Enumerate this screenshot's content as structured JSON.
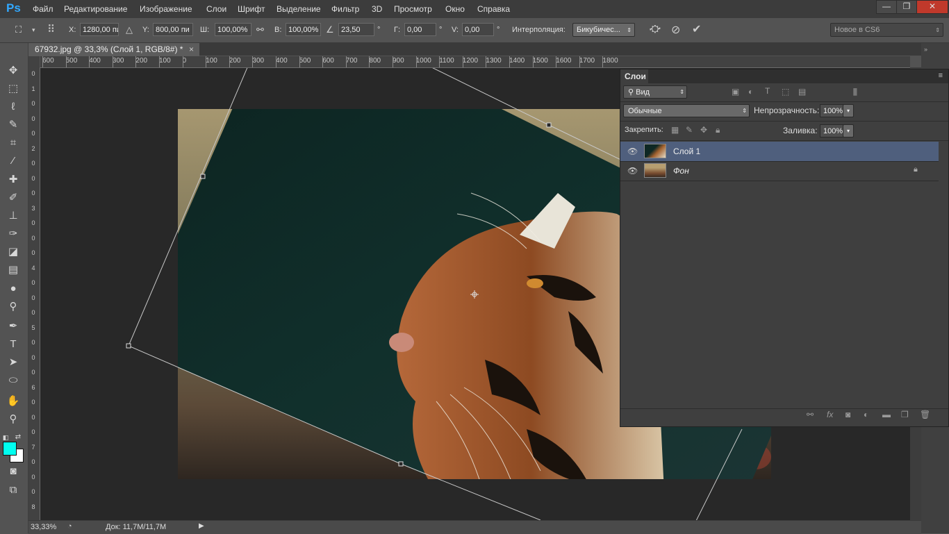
{
  "app": {
    "logo": "Ps",
    "menu": [
      "Файл",
      "Редактирование",
      "Изображение",
      "Слои",
      "Шрифт",
      "Выделение",
      "Фильтр",
      "3D",
      "Просмотр",
      "Окно",
      "Справка"
    ],
    "window_controls": {
      "minimize": "—",
      "restore": "❐",
      "close": "✕"
    }
  },
  "options_bar": {
    "x_label": "X:",
    "x_value": "1280,00 пи",
    "y_label": "Y:",
    "y_value": "800,00 пи",
    "w_label": "Ш:",
    "w_value": "100,00%",
    "h_label": "В:",
    "h_value": "100,00%",
    "angle_value": "23,50",
    "degree": "°",
    "hskew_label": "Г:",
    "hskew_value": "0,00",
    "vskew_label": "V:",
    "vskew_value": "0,00",
    "interp_label": "Интерполяция:",
    "interp_value": "Бикубичес...",
    "workspace": "Новое в CS6"
  },
  "document": {
    "tab_title": "67932.jpg @ 33,3% (Слой 1, RGB/8#) *",
    "tab_close": "×"
  },
  "ruler": {
    "h_labels": [
      "600",
      "500",
      "400",
      "300",
      "200",
      "100",
      "0",
      "100",
      "200",
      "300",
      "400",
      "500",
      "600",
      "700",
      "800",
      "900",
      "1000",
      "1100",
      "1200",
      "1300",
      "1400",
      "1500",
      "1600",
      "1700",
      "1800"
    ],
    "v_labels": [
      "0",
      "1",
      "0",
      "0",
      "0",
      "2",
      "0",
      "0",
      "0",
      "3",
      "0",
      "0",
      "0",
      "4",
      "0",
      "0",
      "0",
      "5",
      "0",
      "0",
      "0",
      "6",
      "0",
      "0",
      "0",
      "7",
      "0",
      "0",
      "0",
      "8"
    ]
  },
  "status": {
    "zoom": "33,33%",
    "doc_info": "Док: 11,7M/11,7M"
  },
  "layers_panel": {
    "title": "Слои",
    "filter_kind": "Вид",
    "blend_mode": "Обычные",
    "opacity_label": "Непрозрачность:",
    "opacity_value": "100%",
    "lock_label": "Закрепить:",
    "fill_label": "Заливка:",
    "fill_value": "100%",
    "layers": [
      {
        "name": "Слой 1",
        "selected": true
      },
      {
        "name": "Фон",
        "selected": false
      }
    ]
  },
  "colors": {
    "foreground": "#00fff0",
    "background": "#ffffff",
    "canvas_bg": "#282828",
    "selected_layer": "#4f5f7d"
  }
}
